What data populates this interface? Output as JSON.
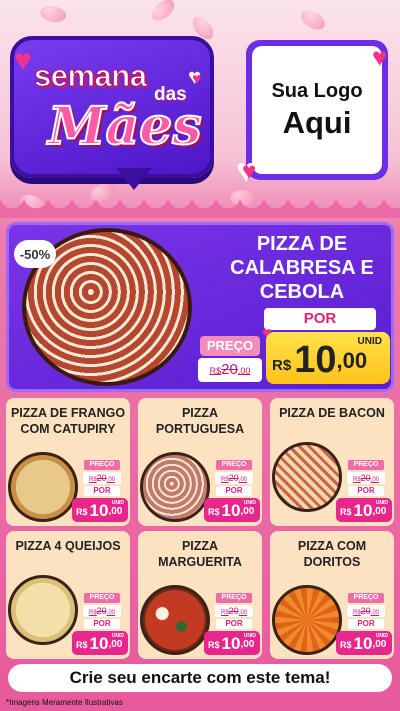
{
  "header": {
    "badge": {
      "line1": "semana",
      "line2": "das",
      "line3": "Mães"
    },
    "logo": {
      "line1": "Sua Logo",
      "line2": "Aqui"
    }
  },
  "featured": {
    "discount": "-50%",
    "title": [
      "PIZZA DE",
      "CALABRESA E",
      "CEBOLA"
    ],
    "preco_label": "PREÇO",
    "old_price": {
      "currency": "R$",
      "value": "20",
      "cents": ",00"
    },
    "por_label": "POR",
    "unid_label": "UNID",
    "price": {
      "currency": "R$",
      "value": "10",
      "cents": ",00"
    }
  },
  "products": [
    {
      "title": [
        "PIZZA DE FRANGO",
        "COM CATUPIRY"
      ],
      "preco_label": "PREÇO",
      "old_currency": "R$",
      "old_value": "20",
      "old_cents": ",00",
      "por_label": "POR",
      "unid_label": "UNID",
      "currency": "R$",
      "value": "10",
      "cents": ",00"
    },
    {
      "title": [
        "PIZZA",
        "PORTUGUESA"
      ],
      "preco_label": "PREÇO",
      "old_currency": "R$",
      "old_value": "20",
      "old_cents": ",00",
      "por_label": "POR",
      "unid_label": "UNID",
      "currency": "R$",
      "value": "10",
      "cents": ",00"
    },
    {
      "title": [
        "PIZZA DE BACON"
      ],
      "preco_label": "PREÇO",
      "old_currency": "R$",
      "old_value": "20",
      "old_cents": ",00",
      "por_label": "POR",
      "unid_label": "UNID",
      "currency": "R$",
      "value": "10",
      "cents": ",00"
    },
    {
      "title": [
        "PIZZA 4 QUEIJOS"
      ],
      "preco_label": "PREÇO",
      "old_currency": "R$",
      "old_value": "20",
      "old_cents": ",00",
      "por_label": "POR",
      "unid_label": "UNID",
      "currency": "R$",
      "value": "10",
      "cents": ",00"
    },
    {
      "title": [
        "PIZZA",
        "MARGUERITA"
      ],
      "preco_label": "PREÇO",
      "old_currency": "R$",
      "old_value": "20",
      "old_cents": ",00",
      "por_label": "POR",
      "unid_label": "UNID",
      "currency": "R$",
      "value": "10",
      "cents": ",00"
    },
    {
      "title": [
        "PIZZA COM",
        "DORITOS"
      ],
      "preco_label": "PREÇO",
      "old_currency": "R$",
      "old_value": "20",
      "old_cents": ",00",
      "por_label": "POR",
      "unid_label": "UNID",
      "currency": "R$",
      "value": "10",
      "cents": ",00"
    }
  ],
  "footer": {
    "cta": "Crie seu encarte com este tema!",
    "disclaimer": "*Imagens Meramente Ilustrativas"
  },
  "colors": {
    "purple": "#6b2ee6",
    "pink": "#e8278c",
    "yellow": "#ffd22e",
    "card": "#fde2c2"
  }
}
